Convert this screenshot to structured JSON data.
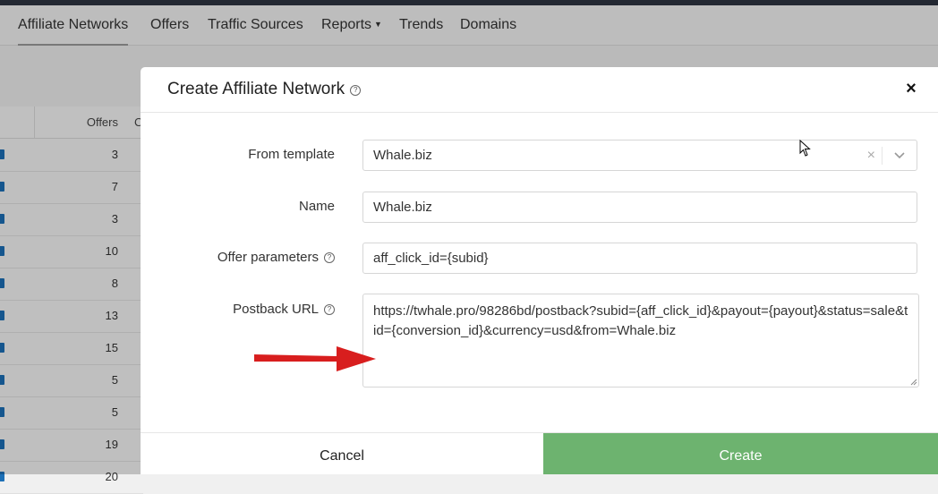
{
  "navbar": {
    "items": [
      {
        "label": "Affiliate Networks"
      },
      {
        "label": "Offers"
      },
      {
        "label": "Traffic Sources"
      },
      {
        "label": "Reports"
      },
      {
        "label": "Trends"
      },
      {
        "label": "Domains"
      }
    ]
  },
  "table": {
    "header_offers": "Offers",
    "header_next": "C",
    "rows": [
      "3",
      "7",
      "3",
      "10",
      "8",
      "13",
      "15",
      "5",
      "5",
      "19",
      "20"
    ]
  },
  "modal": {
    "title": "Create Affiliate Network",
    "close_symbol": "×",
    "fields": {
      "template": {
        "label": "From template",
        "value": "Whale.biz",
        "clear": "×"
      },
      "name": {
        "label": "Name",
        "value": "Whale.biz"
      },
      "offer_params": {
        "label": "Offer parameters",
        "value": "aff_click_id={subid}"
      },
      "postback": {
        "label": "Postback URL",
        "value": "https://twhale.pro/98286bd/postback?subid={aff_click_id}&payout={payout}&status=sale&tid={conversion_id}&currency=usd&from=Whale.biz"
      }
    },
    "help_symbol": "?",
    "cancel_label": "Cancel",
    "create_label": "Create"
  },
  "colors": {
    "create_button": "#6db36f",
    "arrow": "#d81e1e",
    "row_icon": "#1c6fb6"
  },
  "icons": [
    "help-icon",
    "close-icon",
    "chevron-down-icon",
    "clear-icon",
    "mouse-cursor-icon",
    "red-arrow-annotation"
  ]
}
